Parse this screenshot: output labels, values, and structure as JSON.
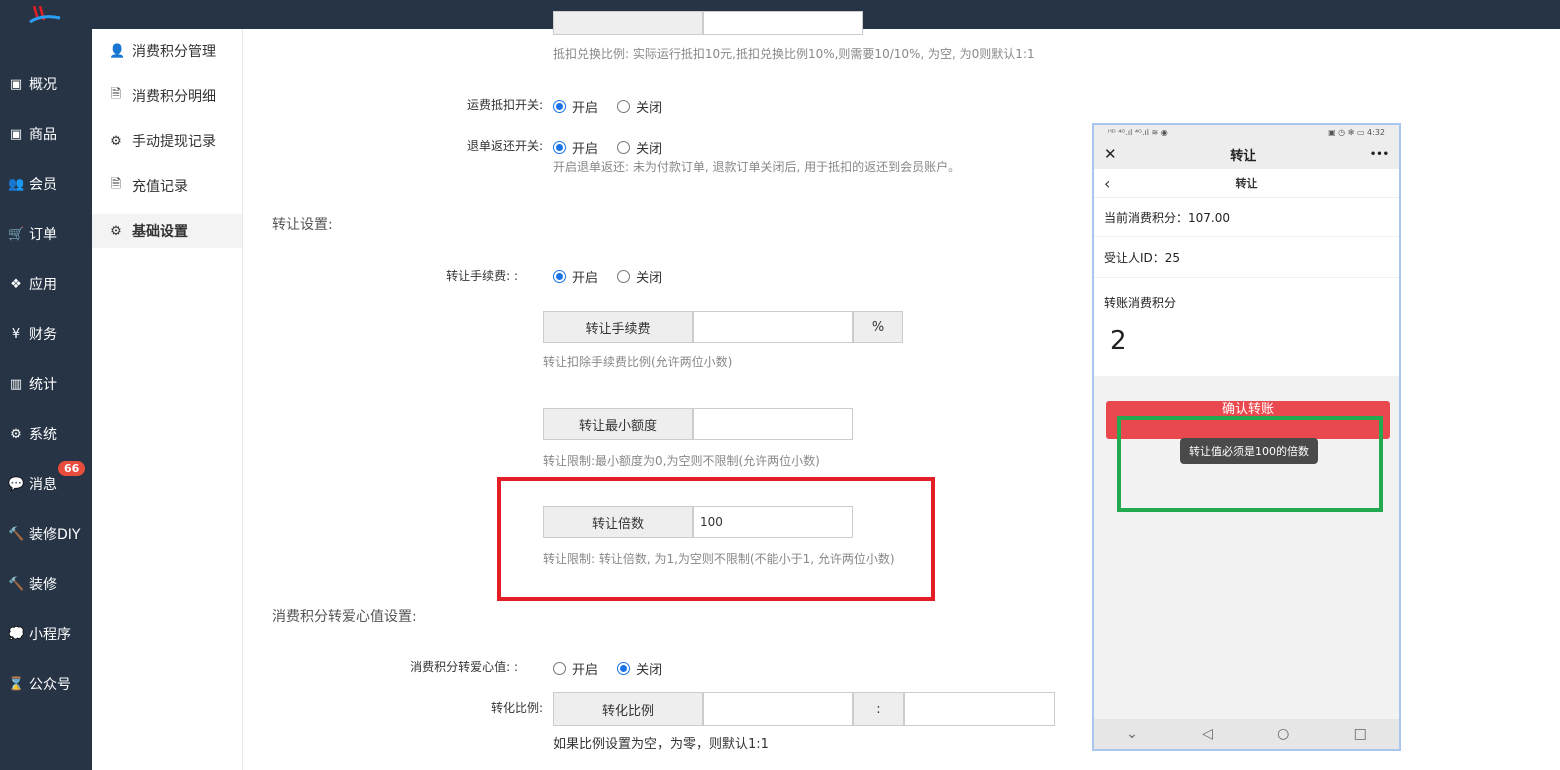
{
  "sidebar": {
    "items": [
      {
        "label": "概况",
        "icon": "archive-icon",
        "glyph": "▣"
      },
      {
        "label": "商品",
        "icon": "archive-icon",
        "glyph": "▣"
      },
      {
        "label": "会员",
        "icon": "users-icon",
        "glyph": "👥"
      },
      {
        "label": "订单",
        "icon": "cart-icon",
        "glyph": "🛒"
      },
      {
        "label": "应用",
        "icon": "cubes-icon",
        "glyph": "❖"
      },
      {
        "label": "财务",
        "icon": "yen-icon",
        "glyph": "¥"
      },
      {
        "label": "统计",
        "icon": "bar-chart-icon",
        "glyph": "▥"
      },
      {
        "label": "系统",
        "icon": "gears-icon",
        "glyph": "⚙"
      },
      {
        "label": "消息",
        "icon": "comment-icon",
        "glyph": "💬",
        "badge": "66"
      },
      {
        "label": "装修DIY",
        "icon": "gavel-icon",
        "glyph": "🔨"
      },
      {
        "label": "装修",
        "icon": "gavel-icon",
        "glyph": "🔨"
      },
      {
        "label": "小程序",
        "icon": "wechat-icon",
        "glyph": "💭"
      },
      {
        "label": "公众号",
        "icon": "hourglass-icon",
        "glyph": "⌛"
      }
    ]
  },
  "subnav": {
    "items": [
      {
        "label": "消费积分管理",
        "icon": "user-icon",
        "glyph": "👤"
      },
      {
        "label": "消费积分明细",
        "icon": "file-icon",
        "glyph": "🗎"
      },
      {
        "label": "手动提现记录",
        "icon": "gears-icon",
        "glyph": "⚙"
      },
      {
        "label": "充值记录",
        "icon": "file-icon",
        "glyph": "🗎"
      },
      {
        "label": "基础设置",
        "icon": "gears-icon",
        "glyph": "⚙",
        "active": true
      }
    ]
  },
  "form": {
    "deduct_hint": "抵扣兑换比例: 实际运行抵扣10元,抵扣兑换比例10%,则需要10/10%, 为空, 为0则默认1:1",
    "freight": {
      "label": "运费抵扣开关:",
      "on": "开启",
      "off": "关闭",
      "value": "on"
    },
    "refund": {
      "label": "退单返还开关:",
      "on": "开启",
      "off": "关闭",
      "value": "on",
      "hint": "开启退单返还: 未为付款订单, 退款订单关闭后, 用于抵扣的返还到会员账户。"
    },
    "transfer_section": "转让设置:",
    "fee_switch": {
      "label": "转让手续费: :",
      "on": "开启",
      "off": "关闭",
      "value": "on"
    },
    "fee": {
      "addon": "转让手续费",
      "value": "",
      "suffix": "%",
      "hint": "转让扣除手续费比例(允许两位小数)"
    },
    "min": {
      "addon": "转让最小额度",
      "value": "",
      "hint": "转让限制:最小额度为0,为空则不限制(允许两位小数)"
    },
    "multiple": {
      "addon": "转让倍数",
      "value": "100",
      "hint": "转让限制: 转让倍数, 为1,为空则不限制(不能小于1, 允许两位小数)"
    },
    "love_section": "消费积分转爱心值设置:",
    "love_switch": {
      "label": "消费积分转爱心值: :",
      "on": "开启",
      "off": "关闭",
      "value": "off"
    },
    "ratio": {
      "label": "转化比例:",
      "addon": "转化比例",
      "value1": "",
      "sep": ":",
      "value2": "",
      "hint": "如果比例设置为空，为零，则默认1:1"
    }
  },
  "phone": {
    "status_left": "ᴴᴰ ⁴ᴳ.ıl ⁴ᴳ.ıl ≋ ◉",
    "status_right": "▣ ◷ ✻ ▭ 4:32",
    "title": "转让",
    "close_glyph": "✕",
    "more_glyph": "•••",
    "back_glyph": "‹",
    "nav_title": "转让",
    "current_label": "当前消费积分：107.00",
    "recipient_label": "受让人ID：25",
    "transfer_label": "转账消费积分",
    "amount": "2",
    "button": "确认转账",
    "toast": "转让值必须是100的倍数",
    "bottom": {
      "down": "⌄",
      "back": "◁",
      "home": "○",
      "recent": "□"
    }
  },
  "colors": {
    "sidebar_bg": "#263445",
    "accent": "#1a73e8",
    "highlight_red": "#e41e26",
    "highlight_green": "#23a94f",
    "phone_button": "#e9494e"
  }
}
